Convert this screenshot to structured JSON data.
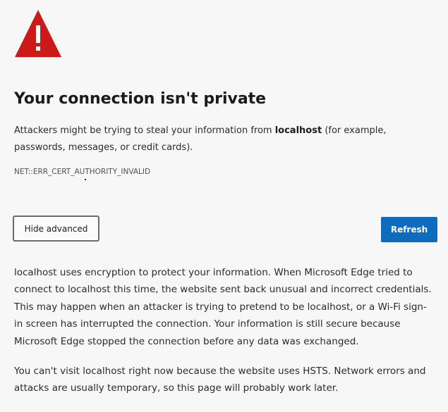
{
  "warning": {
    "icon": "warning-triangle-icon",
    "color": "#cc1a1a"
  },
  "title": "Your connection isn't private",
  "intro": {
    "before": "Attackers might be trying to steal your information from ",
    "host": "localhost",
    "after": " (for example, passwords, messages, or credit cards)."
  },
  "error_code": "NET::ERR_CERT_AUTHORITY_INVALID",
  "buttons": {
    "hide_advanced": "Hide advanced",
    "refresh": "Refresh",
    "refresh_color": "#0f6cbd"
  },
  "advanced": {
    "paragraph1": "localhost uses encryption to protect your information. When Microsoft Edge tried to connect to localhost this time, the website sent back unusual and incorrect credentials. This may happen when an attacker is trying to pretend to be localhost, or a Wi-Fi sign-in screen has interrupted the connection. Your information is still secure because Microsoft Edge stopped the connection before any data was exchanged.",
    "paragraph2": "You can't visit localhost right now because the website uses HSTS. Network errors and attacks are usually temporary, so this page will probably work later."
  }
}
